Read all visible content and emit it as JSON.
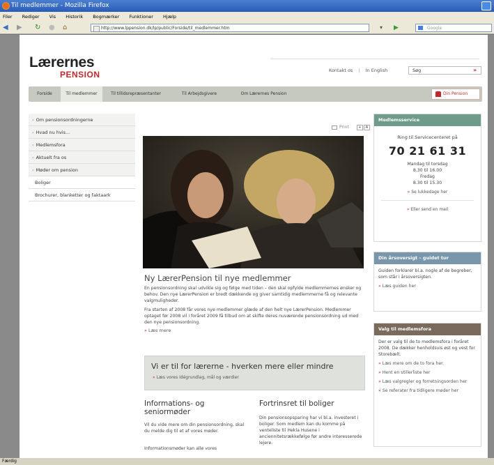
{
  "window": {
    "title": "Til medlemmer - Mozilla Firefox",
    "status": "Færdig"
  },
  "menu": [
    "Filer",
    "Rediger",
    "Vis",
    "Historik",
    "Bogmærker",
    "Funktioner",
    "Hjælp"
  ],
  "toolbar": {
    "url": "http://www.lppension.dk/lp/public/Forside/til_medlemmer.htm",
    "search_placeholder": "Google"
  },
  "site": {
    "logo_main": "Lærernes",
    "logo_sub": "PENSION",
    "header_link_contact": "Kontakt os",
    "header_sep": "|",
    "header_link_english": "In English",
    "search_value": "Søg",
    "search_go": "»"
  },
  "tabs": [
    "Forside",
    "Til medlemmer",
    "Til tillidsrepræsentanter",
    "Til Arbejdsgivere",
    "Om Lærernes Pension"
  ],
  "tab_button": "Din Pension",
  "subnav": [
    "Om pensionsordningerne",
    "Hvad nu hvis...",
    "Medlemsfora",
    "Aktuelt fra os",
    "Møder om pension",
    "Boliger",
    "Brochurer, blanketter og faktaark"
  ],
  "article": {
    "print": "Print",
    "font_small": "+",
    "font_large": "A",
    "headline": "Ny LærerPension til nye medlemmer",
    "para1": "En pensionsordning skal udvikle sig og følge med tiden – den skal opfylde medlemmernes ønsker og behov. Den nye LærerPension er bredt dækkende og giver samtidig medlemmerne få og relevante valgmuligheder.",
    "para2": "Fra starten af 2008 får vores nye medlemmer glæde af den helt nye LærerPension. Medlemmer optaget før 2008 vil i foråret 2009 få tilbud om at skifte deres nuværende pensionsordning ud med den nye pensionsordning.",
    "read_more": "Læs mere"
  },
  "callout": {
    "title": "Vi er til for lærerne - hverken mere eller mindre",
    "link": "Læs vores idégrundlag, mål og værdier"
  },
  "col1": {
    "title": "Informations- og seniormøder",
    "text": "Vil du vide mere om din pensionsordning, skal du melde dig til et af vores møder.",
    "cut": "Informationsmøder kan alle vores"
  },
  "col2": {
    "title": "Fortrinsret til boliger",
    "text": "Din pensionsopsparing har vi bl.a. investeret i boliger. Som medlem kan du komme på venteliste til Hekla Husene i anciennitetsrækkefølge før andre interesserede lejere."
  },
  "sidebar": {
    "service": {
      "title": "Medlemsservice",
      "lead": "Ring til Servicecenteret på",
      "phone": "70 21 61 31",
      "hours": [
        "Mandag til torsdag",
        "8.30 til 16.00",
        "Fredag",
        "8.30 til 15.30"
      ],
      "closed_link": "Se lukkedage her",
      "mail_link": "Eller send en mail"
    },
    "annual": {
      "title": "Din årsoversigt – guidet tur",
      "text": "Guiden forklarer bl.a. nogle af de begreber, som står i årsoversigten.",
      "link": "Læs guiden her"
    },
    "fora": {
      "title": "Valg til medlemsfora",
      "text": "Der er valg til de to medlemsfora i foråret 2008. De dækker henholdsvis øst og vest for Storebælt.",
      "links": [
        "Læs mere om de to fora her.",
        "Hent en stillerliste her",
        "Læs valgregler og forretningsorden her",
        "Se referater fra tidligere møder her"
      ]
    }
  }
}
